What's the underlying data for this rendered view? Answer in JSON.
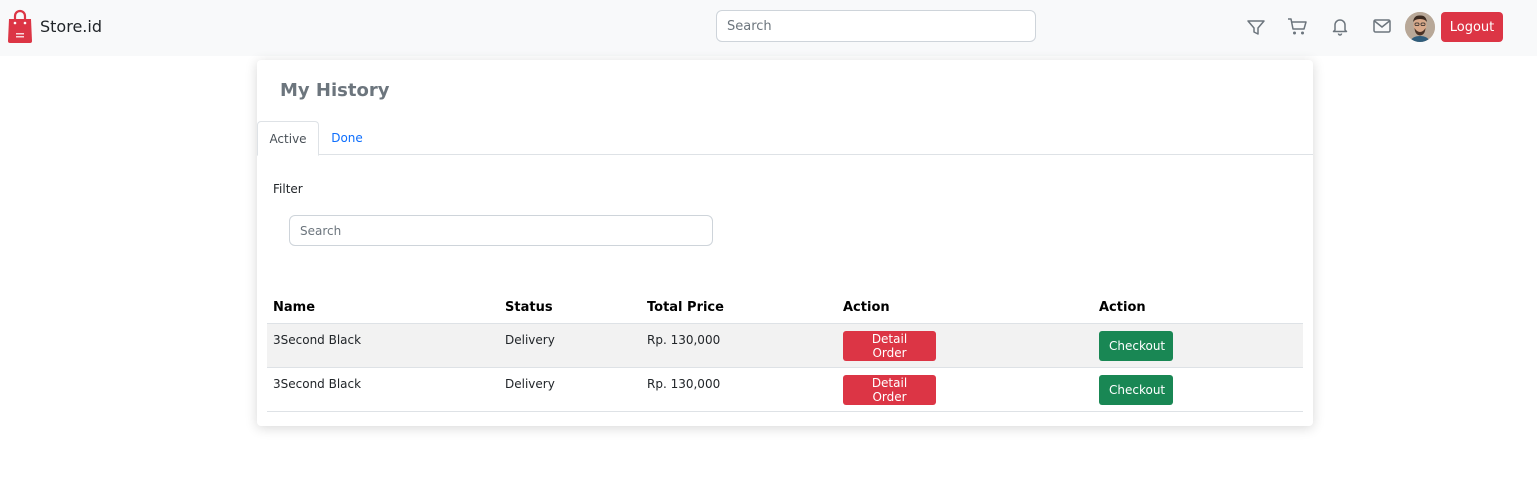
{
  "brand": {
    "name": "Store.id",
    "logo_icon": "shopping-bag-icon",
    "logo_color": "#dc3545"
  },
  "navbar": {
    "search_placeholder": "Search",
    "icons": [
      "filter-icon",
      "cart-icon",
      "bell-icon",
      "mail-icon"
    ],
    "logout_label": "Logout"
  },
  "page": {
    "title": "My History"
  },
  "tabs": [
    {
      "label": "Active",
      "active": true
    },
    {
      "label": "Done",
      "active": false
    }
  ],
  "filter": {
    "label": "Filter",
    "search_placeholder": "Search"
  },
  "table": {
    "headers": [
      "Name",
      "Status",
      "Total Price",
      "Action",
      "Action"
    ],
    "rows": [
      {
        "name": "3Second Black",
        "status": "Delivery",
        "total_price": "Rp. 130,000",
        "detail_label": "Detail Order",
        "checkout_label": "Checkout"
      },
      {
        "name": "3Second Black",
        "status": "Delivery",
        "total_price": "Rp. 130,000",
        "detail_label": "Detail Order",
        "checkout_label": "Checkout"
      }
    ]
  },
  "colors": {
    "danger": "#dc3545",
    "success": "#198754",
    "link": "#0d6efd",
    "navbar_bg": "#f8f9fa"
  }
}
